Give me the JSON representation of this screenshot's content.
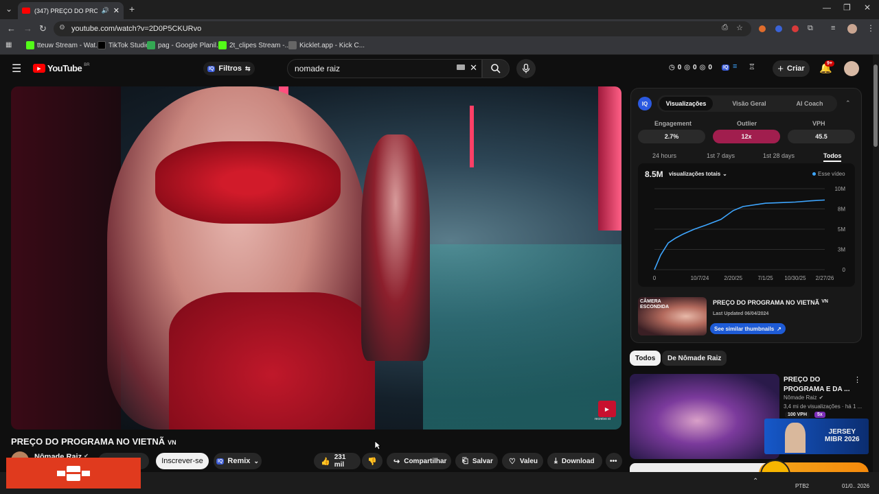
{
  "browser": {
    "tab_title": "(347) PREÇO DO PROGRAMA",
    "url": "youtube.com/watch?v=2D0P5CKURvo",
    "bookmarks": [
      {
        "label": "tteuw Stream - Wat...",
        "color": "#53fc18"
      },
      {
        "label": "TikTok Studio",
        "color": "#000000"
      },
      {
        "label": "pag - Google Planil...",
        "color": "#34a853"
      },
      {
        "label": "2t_clipes Stream -...",
        "color": "#53fc18"
      },
      {
        "label": "Kicklet.app - Kick C...",
        "color": "#666666"
      }
    ]
  },
  "youtube": {
    "logo": "YouTube",
    "region": "BR",
    "filters_label": "Filtros",
    "search_value": "nomade raiz",
    "counters": [
      "0",
      "0",
      "0"
    ],
    "create_label": "Criar",
    "notif_badge": "9+"
  },
  "video": {
    "title": "PREÇO DO PROGRAMA NO VIETNÃ",
    "title_suffix": "VN",
    "channel": "Nômade Raiz",
    "subscribe_label": "Inscrever-se",
    "remix_label": "Remix",
    "likes": "231 mil",
    "share_label": "Compartilhar",
    "save_label": "Salvar",
    "thanks_label": "Valeu",
    "download_label": "Download",
    "watermark": "recreivo st"
  },
  "iq": {
    "badge": "IQ",
    "tabs": [
      "Visualizações",
      "Visão Geral",
      "AI Coach"
    ],
    "active_tab": 0,
    "stats": [
      {
        "label": "Engagement",
        "value": "2.7%"
      },
      {
        "label": "Outlier",
        "value": "12x"
      },
      {
        "label": "VPH",
        "value": "45.5"
      }
    ],
    "ranges": [
      "24 hours",
      "1st 7 days",
      "1st 28 days",
      "Todos"
    ],
    "active_range": 3,
    "total_views": "8.5M",
    "metric_select": "visualizações totais",
    "legend": "Esse vídeo",
    "thumb_title": "PREÇO DO PROGRAMA NO VIETNÃ",
    "thumb_suffix": "VN",
    "last_updated": "Last Updated 06/04/2024",
    "similar_btn": "See similar thumbnails",
    "thumb_caption": "CÂMERA ESCONDIDA"
  },
  "chart_data": {
    "type": "line",
    "x": [
      "2024-04-06",
      "2024-05-01",
      "2024-06-01",
      "2024-07-01",
      "2024-08-01",
      "2024-09-15",
      "2024-11-01",
      "2025-01-01",
      "2025-02-20",
      "2025-04-01",
      "2025-07-01",
      "2025-10-30",
      "2026-01-01",
      "2026-02-27"
    ],
    "values": [
      0,
      1.8,
      3.3,
      3.9,
      4.4,
      5.0,
      5.5,
      6.2,
      7.3,
      7.8,
      8.2,
      8.35,
      8.5,
      8.6
    ],
    "series_name": "Esse vídeo",
    "ylabel": "",
    "xlabel": "",
    "ytick_labels": [
      "0",
      "3M",
      "5M",
      "8M",
      "10M"
    ],
    "yticks": [
      0,
      2.5,
      5,
      7.5,
      10
    ],
    "xtick_labels": [
      "0",
      "10/7/24",
      "2/20/25",
      "7/1/25",
      "10/30/25",
      "2/27/26"
    ],
    "ylim": [
      0,
      10
    ],
    "grid": true,
    "line_color": "#3ea6ff"
  },
  "sidebar": {
    "chips": [
      "Todos",
      "De Nômade Raiz"
    ],
    "rec": {
      "title_line1": "PREÇO DO",
      "title_line2": "PROGRAMA E DA ...",
      "channel": "Nômade Raiz",
      "meta": "3,4 mi de visualizações · há 1 ...",
      "vph": "100 VPH",
      "outlier": "5x"
    },
    "ad_line1": "JERSEY",
    "ad_line2": "MIBR 2026"
  },
  "taskbar": {
    "lang": "PTB2",
    "date": "01/0.. 2026"
  }
}
